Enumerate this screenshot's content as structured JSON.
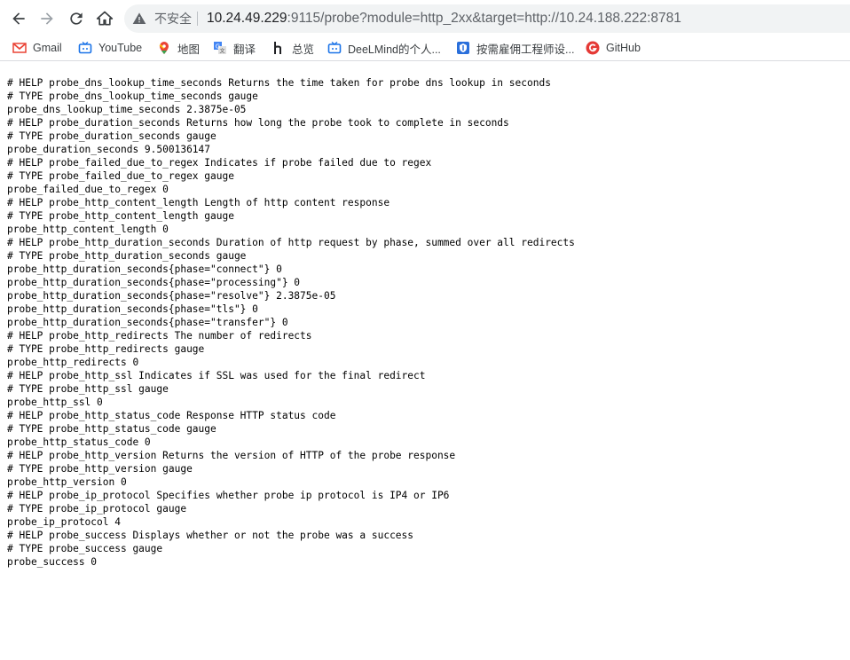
{
  "browser": {
    "security_label": "不安全",
    "url_host": "10.24.49.229",
    "url_rest": ":9115/probe?module=http_2xx&target=http://10.24.188.222:8781"
  },
  "bookmarks": [
    {
      "label": "Gmail",
      "icon": "gmail-icon"
    },
    {
      "label": "YouTube",
      "icon": "youtube-icon"
    },
    {
      "label": "地图",
      "icon": "maps-pin-icon"
    },
    {
      "label": "翻译",
      "icon": "translate-icon"
    },
    {
      "label": "总览",
      "icon": "overview-h-icon"
    },
    {
      "label": "DeeLMind的个人...",
      "icon": "tv-icon"
    },
    {
      "label": "按需雇佣工程师设...",
      "icon": "shield-badge-icon"
    },
    {
      "label": "GitHub",
      "icon": "github-icon"
    }
  ],
  "colors": {
    "gmail": "#ea4335",
    "youtube": "#1a73e8",
    "maps": "#ea4335",
    "github": "#e53935"
  },
  "content_lines": [
    "# HELP probe_dns_lookup_time_seconds Returns the time taken for probe dns lookup in seconds",
    "# TYPE probe_dns_lookup_time_seconds gauge",
    "probe_dns_lookup_time_seconds 2.3875e-05",
    "# HELP probe_duration_seconds Returns how long the probe took to complete in seconds",
    "# TYPE probe_duration_seconds gauge",
    "probe_duration_seconds 9.500136147",
    "# HELP probe_failed_due_to_regex Indicates if probe failed due to regex",
    "# TYPE probe_failed_due_to_regex gauge",
    "probe_failed_due_to_regex 0",
    "# HELP probe_http_content_length Length of http content response",
    "# TYPE probe_http_content_length gauge",
    "probe_http_content_length 0",
    "# HELP probe_http_duration_seconds Duration of http request by phase, summed over all redirects",
    "# TYPE probe_http_duration_seconds gauge",
    "probe_http_duration_seconds{phase=\"connect\"} 0",
    "probe_http_duration_seconds{phase=\"processing\"} 0",
    "probe_http_duration_seconds{phase=\"resolve\"} 2.3875e-05",
    "probe_http_duration_seconds{phase=\"tls\"} 0",
    "probe_http_duration_seconds{phase=\"transfer\"} 0",
    "# HELP probe_http_redirects The number of redirects",
    "# TYPE probe_http_redirects gauge",
    "probe_http_redirects 0",
    "# HELP probe_http_ssl Indicates if SSL was used for the final redirect",
    "# TYPE probe_http_ssl gauge",
    "probe_http_ssl 0",
    "# HELP probe_http_status_code Response HTTP status code",
    "# TYPE probe_http_status_code gauge",
    "probe_http_status_code 0",
    "# HELP probe_http_version Returns the version of HTTP of the probe response",
    "# TYPE probe_http_version gauge",
    "probe_http_version 0",
    "# HELP probe_ip_protocol Specifies whether probe ip protocol is IP4 or IP6",
    "# TYPE probe_ip_protocol gauge",
    "probe_ip_protocol 4",
    "# HELP probe_success Displays whether or not the probe was a success",
    "# TYPE probe_success gauge",
    "probe_success 0"
  ]
}
